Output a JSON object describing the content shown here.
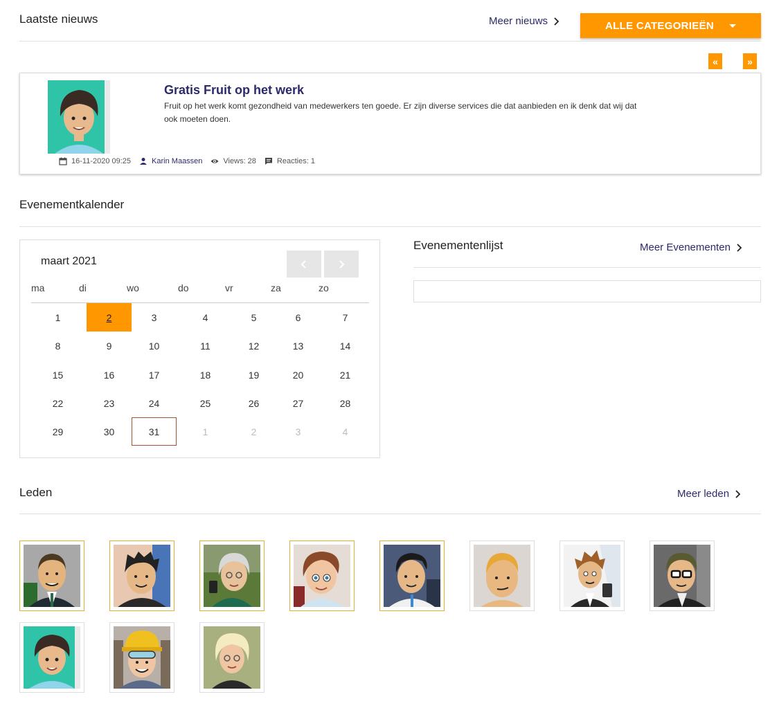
{
  "news": {
    "title": "Laatste nieuws",
    "more_label": "Meer nieuws",
    "category_button": "ALLE CATEGORIEËN",
    "pager_prev": "«",
    "pager_next": "»",
    "article": {
      "title": "Gratis Fruit op het werk",
      "text": "Fruit op het werk komt gezondheid van medewerkers ten goede. Er zijn diverse services die dat aanbieden en ik denk dat wij dat ook moeten doen.",
      "date": "16-11-2020 09:25",
      "author": "Karin Maassen",
      "views": "Views: 28",
      "comments": "Reacties: 1"
    }
  },
  "events": {
    "title": "Evenementkalender",
    "calendar": {
      "month_label": "maart 2021",
      "weekdays": [
        "ma",
        "di",
        "wo",
        "do",
        "vr",
        "za",
        "zo"
      ],
      "weeks": [
        [
          "1",
          "2",
          "3",
          "4",
          "5",
          "6",
          "7"
        ],
        [
          "8",
          "9",
          "10",
          "11",
          "12",
          "13",
          "14"
        ],
        [
          "15",
          "16",
          "17",
          "18",
          "19",
          "20",
          "21"
        ],
        [
          "22",
          "23",
          "24",
          "25",
          "26",
          "27",
          "28"
        ],
        [
          "29",
          "30",
          "31",
          "1",
          "2",
          "3",
          "4"
        ]
      ],
      "today": "2",
      "selected": "31"
    },
    "list_title": "Evenementenlijst",
    "more_label": "Meer Evenementen"
  },
  "members": {
    "title": "Leden",
    "more_label": "Meer leden"
  },
  "colors": {
    "accent": "#ff9800",
    "link": "#2c2a6b",
    "member_highlight": "#e0b030"
  }
}
